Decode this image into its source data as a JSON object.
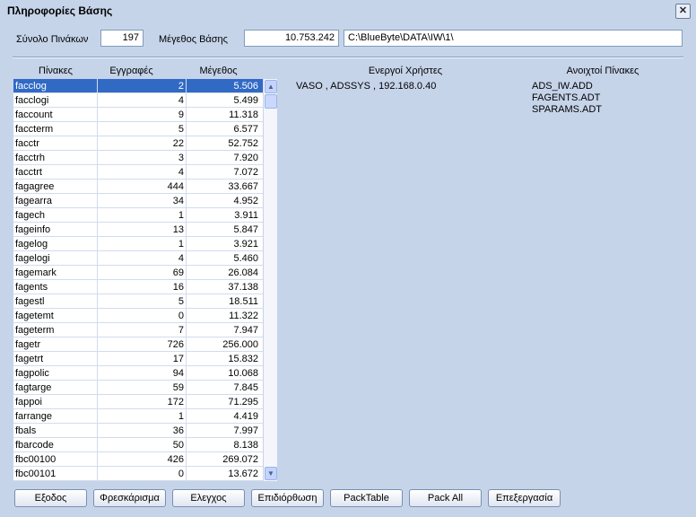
{
  "window": {
    "title": "Πληροφορίες Βάσης"
  },
  "summary": {
    "tables_label": "Σύνολο Πινάκων",
    "tables_value": "197",
    "size_label": "Μέγεθος Βάσης",
    "size_value": "10.753.242",
    "path_value": "C:\\BlueByte\\DATA\\IW\\1\\"
  },
  "grid": {
    "headers": [
      "Πίνακες",
      "Εγγραφές",
      "Μέγεθος"
    ],
    "rows": [
      [
        "facclog",
        "2",
        "5.506"
      ],
      [
        "facclogi",
        "4",
        "5.499"
      ],
      [
        "faccount",
        "9",
        "11.318"
      ],
      [
        "faccterm",
        "5",
        "6.577"
      ],
      [
        "facctr",
        "22",
        "52.752"
      ],
      [
        "facctrh",
        "3",
        "7.920"
      ],
      [
        "facctrt",
        "4",
        "7.072"
      ],
      [
        "fagagree",
        "444",
        "33.667"
      ],
      [
        "fagearra",
        "34",
        "4.952"
      ],
      [
        "fagech",
        "1",
        "3.911"
      ],
      [
        "fageinfo",
        "13",
        "5.847"
      ],
      [
        "fagelog",
        "1",
        "3.921"
      ],
      [
        "fagelogi",
        "4",
        "5.460"
      ],
      [
        "fagemark",
        "69",
        "26.084"
      ],
      [
        "fagents",
        "16",
        "37.138"
      ],
      [
        "fagestl",
        "5",
        "18.511"
      ],
      [
        "fagetemt",
        "0",
        "11.322"
      ],
      [
        "fageterm",
        "7",
        "7.947"
      ],
      [
        "fagetr",
        "726",
        "256.000"
      ],
      [
        "fagetrt",
        "17",
        "15.832"
      ],
      [
        "fagpolic",
        "94",
        "10.068"
      ],
      [
        "fagtarge",
        "59",
        "7.845"
      ],
      [
        "fappoi",
        "172",
        "71.295"
      ],
      [
        "farrange",
        "1",
        "4.419"
      ],
      [
        "fbals",
        "36",
        "7.997"
      ],
      [
        "fbarcode",
        "50",
        "8.138"
      ],
      [
        "fbc00100",
        "426",
        "269.072"
      ],
      [
        "fbc00101",
        "0",
        "13.672"
      ]
    ]
  },
  "users": {
    "header": "Ενεργοί Χρήστες",
    "items": [
      "VASO , ADSSYS , 192.168.0.40"
    ]
  },
  "open_tables": {
    "header": "Ανοιχτοί Πίνακες",
    "items": [
      "ADS_IW.ADD",
      "FAGENTS.ADT",
      "SPARAMS.ADT"
    ]
  },
  "buttons": [
    "Εξοδος",
    "Φρεσκάρισμα",
    "Ελεγχος",
    "Επιδιόρθωση",
    "PackTable",
    "Pack All",
    "Επεξεργασία"
  ],
  "icons": {
    "close": "close-icon",
    "scroll_up": "scroll-up-arrow-icon",
    "scroll_down": "scroll-down-arrow-icon"
  },
  "colors": {
    "background": "#c6d4ea",
    "selection": "#316ac5"
  }
}
